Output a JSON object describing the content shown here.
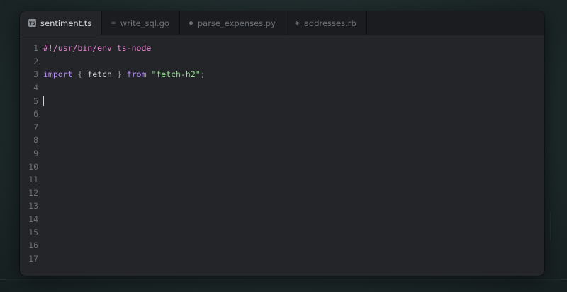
{
  "tabs": [
    {
      "label": "sentiment.ts",
      "icon": "typescript-icon",
      "icon_text": "TS",
      "active": true
    },
    {
      "label": "write_sql.go",
      "icon": "go-icon",
      "icon_text": "∞",
      "active": false
    },
    {
      "label": "parse_expenses.py",
      "icon": "python-icon",
      "icon_text": "◆",
      "active": false
    },
    {
      "label": "addresses.rb",
      "icon": "ruby-icon",
      "icon_text": "◈",
      "active": false
    }
  ],
  "code": {
    "line_numbers": [
      "1",
      "2",
      "3",
      "4",
      "5",
      "6",
      "7",
      "8",
      "9",
      "10",
      "11",
      "12",
      "13",
      "14",
      "15",
      "16",
      "17"
    ],
    "line1": {
      "shebang": "#!/usr/bin/env ts-node"
    },
    "line3": {
      "keyword_import": "import",
      "brace_open": "{",
      "ident": "fetch",
      "brace_close": "}",
      "keyword_from": "from",
      "string": "\"fetch-h2\"",
      "semicolon": ";"
    },
    "cursor_line": "5"
  },
  "colors": {
    "shebang": "#e88ad2",
    "keyword": "#b58df0",
    "string": "#8fe08a",
    "editor_bg": "#232528"
  }
}
